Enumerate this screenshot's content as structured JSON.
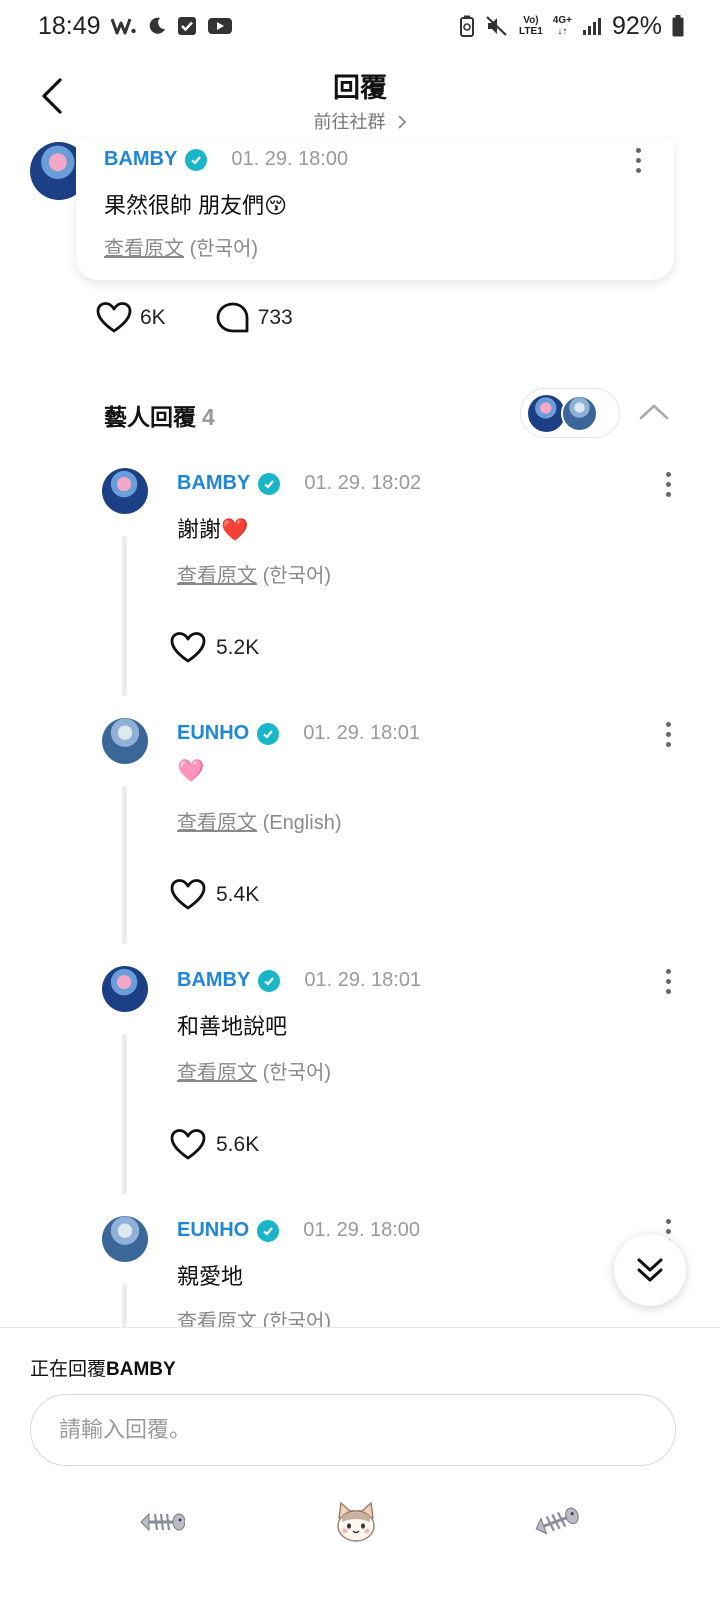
{
  "status_bar": {
    "time": "18:49",
    "battery": "92%",
    "network_top": "Vo)",
    "network_bottom": "LTE1",
    "signal_label": "4G+"
  },
  "header": {
    "title": "回覆",
    "subtitle": "前往社群"
  },
  "post": {
    "author": "BAMBY",
    "time": "01. 29. 18:00",
    "text": "果然很帥 朋友們😚",
    "view_original": "查看原文",
    "language": "(한국어)",
    "likes": "6K",
    "comments": "733"
  },
  "artist_replies": {
    "title": "藝人回覆",
    "count": "4",
    "items": [
      {
        "author": "BAMBY",
        "time": "01. 29. 18:02",
        "text": "謝謝❤️",
        "view_original": "查看原文",
        "language": "(한국어)",
        "likes": "5.2K"
      },
      {
        "author": "EUNHO",
        "time": "01. 29. 18:01",
        "text": "🩷",
        "view_original": "查看原文",
        "language": "(English)",
        "likes": "5.4K"
      },
      {
        "author": "BAMBY",
        "time": "01. 29. 18:01",
        "text": "和善地說吧",
        "view_original": "查看原文",
        "language": "(한국어)",
        "likes": "5.6K"
      },
      {
        "author": "EUNHO",
        "time": "01. 29. 18:00",
        "text": "親愛地",
        "view_original": "查看原文",
        "language": "(한국어)"
      }
    ]
  },
  "compose": {
    "replying_prefix": "正在回覆",
    "replying_to": "BAMBY",
    "placeholder": "請輸入回覆。"
  },
  "colors": {
    "name_blue": "#1f86d8",
    "verify_teal": "#19b5c9",
    "muted_gray": "#9a9a9a"
  }
}
